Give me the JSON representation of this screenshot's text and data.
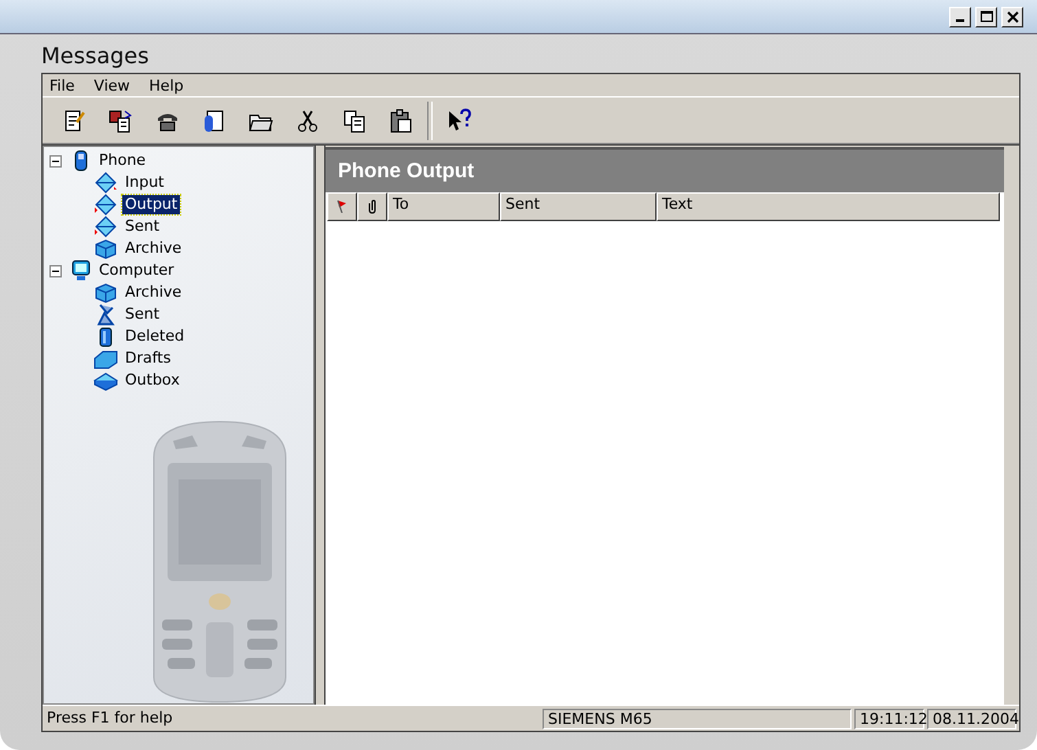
{
  "window": {
    "title": "Messages"
  },
  "menu": [
    "File",
    "View",
    "Help"
  ],
  "tree": [
    {
      "label": "Phone",
      "expanded": true,
      "children": [
        {
          "label": "Input",
          "selected": false
        },
        {
          "label": "Output",
          "selected": true
        },
        {
          "label": "Sent",
          "selected": false
        },
        {
          "label": "Archive",
          "selected": false
        }
      ]
    },
    {
      "label": "Computer",
      "expanded": true,
      "children": [
        {
          "label": "Archive",
          "selected": false
        },
        {
          "label": "Sent",
          "selected": false
        },
        {
          "label": "Deleted",
          "selected": false
        },
        {
          "label": "Drafts",
          "selected": false
        },
        {
          "label": "Outbox",
          "selected": false
        }
      ]
    }
  ],
  "panel": {
    "title": "Phone Output",
    "columns": [
      "To",
      "Sent",
      "Text"
    ]
  },
  "status_bar": {
    "hint": "Press F1 for help",
    "device": "SIEMENS M65",
    "time": "19:11:12",
    "date": "08.11.2004"
  }
}
